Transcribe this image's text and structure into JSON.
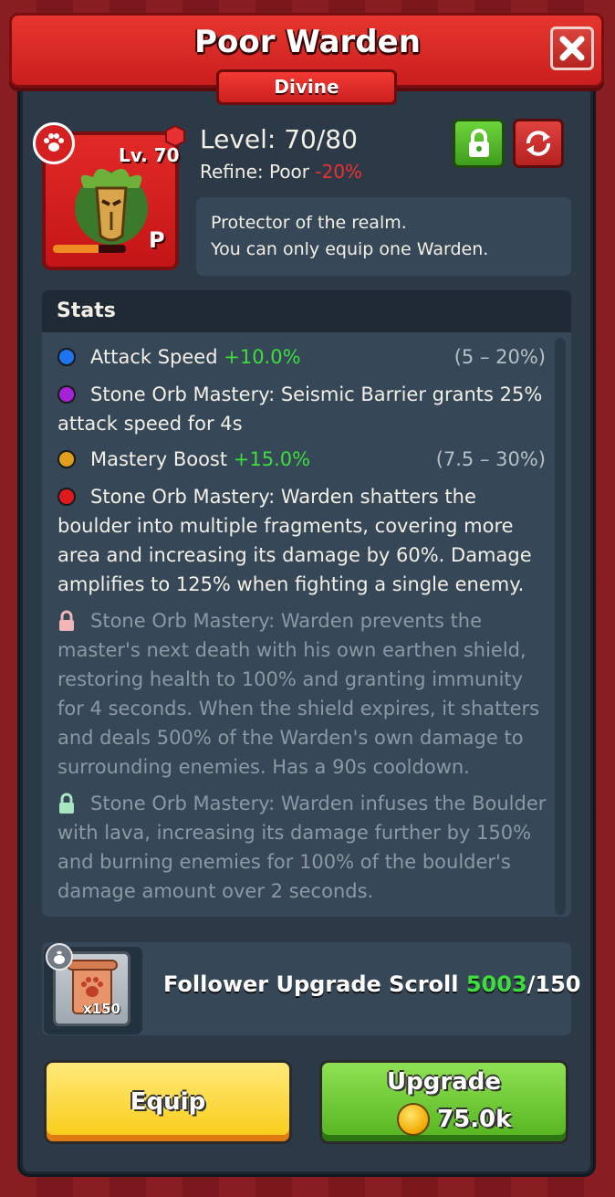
{
  "header": {
    "title": "Poor Warden",
    "rarity": "Divine"
  },
  "portrait": {
    "level_tag": "Lv. 70",
    "grade": "P",
    "xp_fraction": 0.62
  },
  "info": {
    "level": "Level: 70/80",
    "refine_label": "Refine: Poor",
    "refine_value": "-20%",
    "description_line1": "Protector of the realm.",
    "description_line2": "You can only equip one Warden."
  },
  "stats": {
    "heading": "Stats",
    "items": [
      {
        "color": "#1e74f0",
        "label": "Attack Speed",
        "value": "+10.0%",
        "range": "(5 – 20%)"
      },
      {
        "color": "#a622d8",
        "text": "Stone Orb Mastery: Seismic Barrier grants 25% attack speed for 4s"
      },
      {
        "color": "#e0a019",
        "label": "Mastery Boost",
        "value": "+15.0%",
        "range": "(7.5 – 30%)"
      },
      {
        "color": "#e01a1a",
        "text": "Stone Orb Mastery: Warden shatters the boulder into multiple fragments, covering more area and increasing its damage by 60%. Damage amplifies to 125% when fighting a single enemy."
      },
      {
        "lock_color": "#f0b6b6",
        "text": "Stone Orb Mastery: Warden prevents the master's next death with his own earthen shield, restoring health to 100% and granting immunity for 4 seconds. When the shield expires, it shatters and deals 500% of the Warden's own damage to surrounding enemies. Has a 90s cooldown."
      },
      {
        "lock_color": "#a8e6c2",
        "text": "Stone Orb Mastery: Warden infuses the Boulder with lava, increasing its damage further by 150% and burning enemies for 100% of the boulder's damage amount over 2 seconds."
      }
    ]
  },
  "scroll": {
    "count_label": "x150",
    "name": "Follower Upgrade Scroll",
    "owned": "5003",
    "required": "/150"
  },
  "buttons": {
    "equip": "Equip",
    "upgrade": "Upgrade",
    "upgrade_cost": "75.0k"
  },
  "colors": {
    "accent_red": "#e8362e",
    "positive_green": "#3ddd3d",
    "negative_red": "#f03030"
  }
}
